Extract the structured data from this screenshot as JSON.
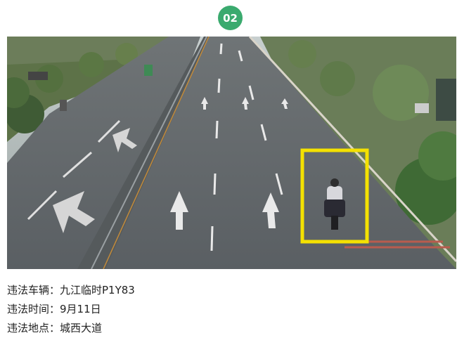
{
  "badge": {
    "number": "02"
  },
  "photo": {
    "description_icon": "traffic-camera-image",
    "highlight_color": "#f4e100"
  },
  "captions": [
    {
      "label": "违法车辆：",
      "value": "九江临时P1Y83"
    },
    {
      "label": "违法时间：",
      "value": "9月11日"
    },
    {
      "label": "违法地点：",
      "value": "城西大道"
    }
  ]
}
